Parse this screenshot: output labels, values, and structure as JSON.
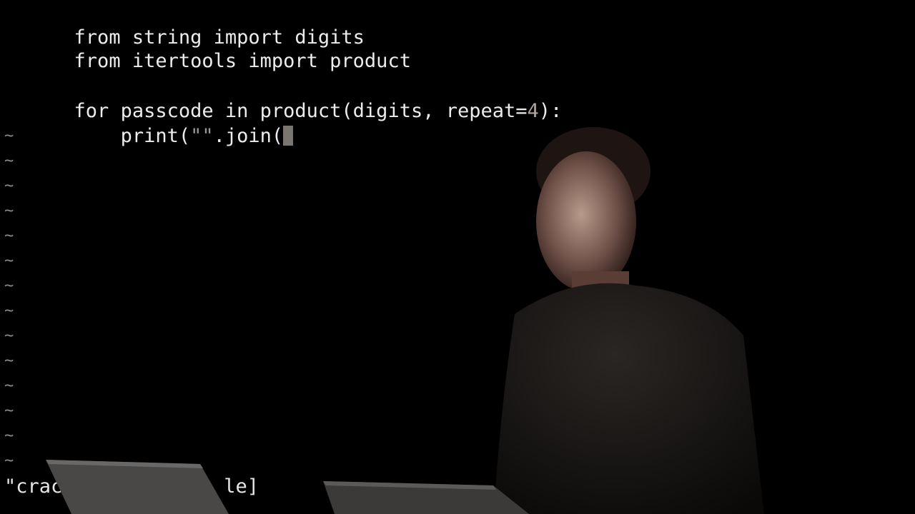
{
  "editor": {
    "lines": [
      {
        "text": "from string import digits"
      },
      {
        "text": "from itertools import product"
      },
      {
        "text": ""
      },
      {
        "before": "for passcode in product(digits, repeat=",
        "digit": "4",
        "after": "):"
      },
      {
        "indent": "    ",
        "call": "print(",
        "quotes": "\"\"",
        "rest": ".join("
      }
    ],
    "empty_line_marker": "~",
    "empty_line_count": 14,
    "status_left": "\"crac",
    "status_right": "le]"
  },
  "icons": {
    "cursor": "block-cursor-icon"
  },
  "colors": {
    "background": "#000000",
    "text": "#ececec",
    "tilde": "#8a8a8a",
    "cursor": "#7b756f"
  }
}
